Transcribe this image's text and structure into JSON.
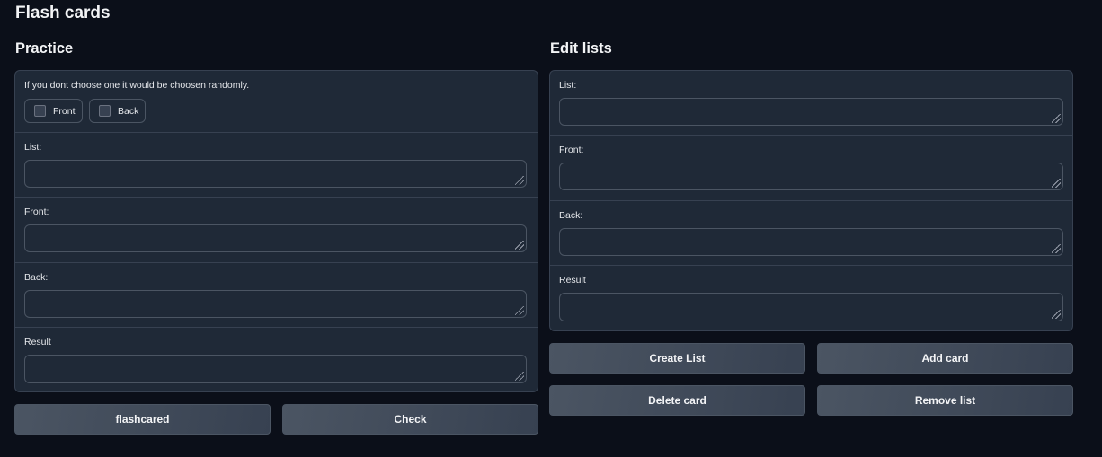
{
  "app": {
    "title": "Flash cards"
  },
  "practice": {
    "title": "Practice",
    "hint": "If you dont choose one it would be choosen randomly.",
    "checkbox_front": "Front",
    "checkbox_back": "Back",
    "list_label": "List:",
    "front_label": "Front:",
    "back_label": "Back:",
    "result_label": "Result",
    "button_flashcard": "flashcared",
    "button_check": "Check"
  },
  "edit": {
    "title": "Edit lists",
    "list_label": "List:",
    "front_label": "Front:",
    "back_label": "Back:",
    "result_label": "Result",
    "button_create_list": "Create List",
    "button_add_card": "Add card",
    "button_delete_card": "Delete card",
    "button_remove_list": "Remove list"
  },
  "colors": {
    "background": "#0b0f19",
    "panel": "#1f2937",
    "border": "#374151",
    "button": "#4b5563"
  }
}
